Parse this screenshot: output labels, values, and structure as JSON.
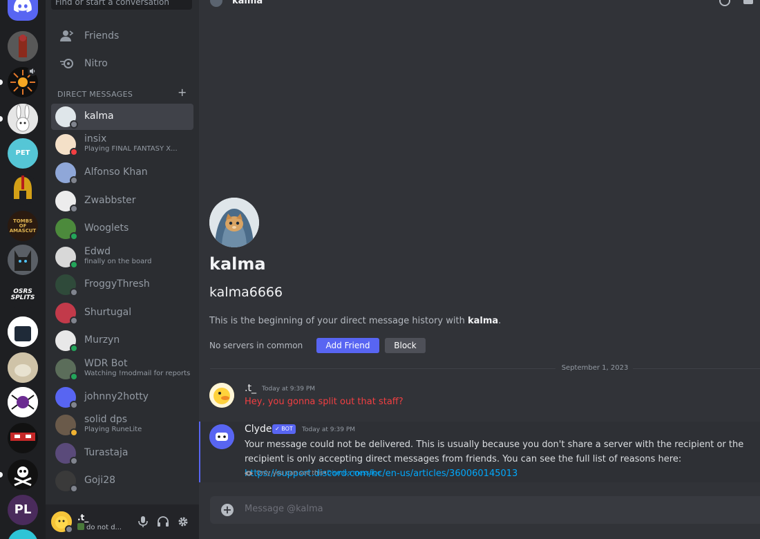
{
  "search": {
    "placeholder": "Find or start a conversation"
  },
  "nav": {
    "friends": "Friends",
    "nitro": "Nitro"
  },
  "dm_header": "DIRECT MESSAGES",
  "dm_add": "+",
  "dms": [
    {
      "name": "kalma",
      "sub": "",
      "status": "offline",
      "active": true
    },
    {
      "name": "insix",
      "sub": "Playing FINAL FANTASY X...",
      "status": "dnd",
      "active": false
    },
    {
      "name": "Alfonso Khan",
      "sub": "",
      "status": "offline",
      "active": false
    },
    {
      "name": "Zwabbster",
      "sub": "",
      "status": "offline",
      "active": false
    },
    {
      "name": "Wooglets",
      "sub": "",
      "status": "online",
      "active": false
    },
    {
      "name": "Edwd",
      "sub": "finally on the board",
      "status": "online",
      "active": false
    },
    {
      "name": "FroggyThresh",
      "sub": "",
      "status": "offline",
      "active": false
    },
    {
      "name": "Shurtugal",
      "sub": "",
      "status": "offline",
      "active": false
    },
    {
      "name": "Murzyn",
      "sub": "",
      "status": "online",
      "active": false
    },
    {
      "name": "WDR Bot",
      "sub": "Watching !modmail for reports",
      "status": "online",
      "active": false
    },
    {
      "name": "johnny2hotty",
      "sub": "",
      "status": "offline",
      "active": false
    },
    {
      "name": "solid dps",
      "sub": "Playing RuneLite",
      "status": "idle",
      "active": false
    },
    {
      "name": "Turastaja",
      "sub": "",
      "status": "offline",
      "active": false
    },
    {
      "name": "Goji28",
      "sub": "",
      "status": "offline",
      "active": false
    }
  ],
  "user_panel": {
    "name": ".t_",
    "status_text": "do not d..."
  },
  "servers": {
    "osrs_splits": "OSRS SPLITS",
    "pet": "PET",
    "toa": "TOMBS OF AMASCUT",
    "pl": "PL"
  },
  "header": {
    "name": "kalma"
  },
  "profile": {
    "display_name": "kalma",
    "username": "kalma6666",
    "intro_prefix": "This is the beginning of your direct message history with ",
    "intro_name": "kalma",
    "intro_suffix": ".",
    "no_servers": "No servers in common",
    "add_friend": "Add Friend",
    "block": "Block"
  },
  "date_divider": "September 1, 2023",
  "messages": [
    {
      "author": ".t_",
      "time": "Today at 9:39 PM",
      "text": "Hey, you gonna split out that staff?"
    },
    {
      "author": "Clyde",
      "bot_tag": "BOT",
      "time": "Today at 9:39 PM",
      "text": "Your message could not be delivered. This is usually because you don't share a server with the recipient or the recipient is only accepting direct messages from friends. You can see the full list of reasons here: ",
      "link": "https://support.discord.com/hc/en-us/articles/360060145013",
      "ephemeral": "Only you can see this",
      "separator": " • ",
      "dismiss": "Dismiss message"
    }
  ],
  "composer": {
    "placeholder": "Message @kalma"
  },
  "colors": {
    "accent": "#5865f2",
    "online": "#23a55a",
    "dnd": "#f23f42",
    "idle": "#f0b232",
    "offline": "#80848e",
    "error_text": "#f23f42",
    "link": "#00a8fc"
  }
}
